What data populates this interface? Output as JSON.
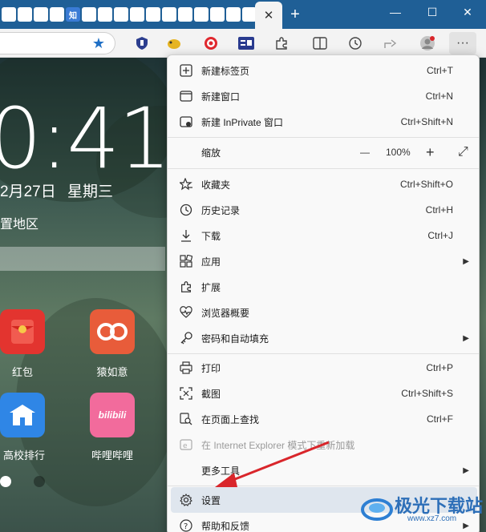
{
  "tabs": {
    "favicon_labels": [
      "",
      "",
      "",
      "",
      "知",
      "",
      "",
      "",
      "",
      "",
      "",
      "",
      "",
      "",
      "",
      ""
    ],
    "close": "✕",
    "new_tab": "+"
  },
  "window": {
    "minimize": "—",
    "maximize": "☐",
    "close": "✕"
  },
  "wallpaper": {
    "time": "0:41",
    "date": "2月27日",
    "weekday": "星期三",
    "location": "置地区",
    "apps": [
      {
        "label": "红包"
      },
      {
        "label": "猿如意"
      },
      {
        "label": "高校排行"
      },
      {
        "label": "哔哩哔哩",
        "tile_text": "bilibili"
      }
    ]
  },
  "menu": {
    "items": [
      {
        "label": "新建标签页",
        "shortcut": "Ctrl+T",
        "icon": "new-tab-icon"
      },
      {
        "label": "新建窗口",
        "shortcut": "Ctrl+N",
        "icon": "new-window-icon"
      },
      {
        "label": "新建 InPrivate 窗口",
        "shortcut": "Ctrl+Shift+N",
        "icon": "inprivate-icon"
      },
      {
        "label": "缩放",
        "icon": ""
      },
      {
        "label": "收藏夹",
        "shortcut": "Ctrl+Shift+O",
        "icon": "favorites-icon"
      },
      {
        "label": "历史记录",
        "shortcut": "Ctrl+H",
        "icon": "history-icon"
      },
      {
        "label": "下载",
        "shortcut": "Ctrl+J",
        "icon": "download-icon"
      },
      {
        "label": "应用",
        "icon": "apps-icon",
        "submenu": true
      },
      {
        "label": "扩展",
        "icon": "extensions-icon"
      },
      {
        "label": "浏览器概要",
        "icon": "browser-essentials-icon"
      },
      {
        "label": "密码和自动填充",
        "icon": "key-icon",
        "submenu": true
      },
      {
        "label": "打印",
        "shortcut": "Ctrl+P",
        "icon": "print-icon"
      },
      {
        "label": "截图",
        "shortcut": "Ctrl+Shift+S",
        "icon": "screenshot-icon"
      },
      {
        "label": "在页面上查找",
        "shortcut": "Ctrl+F",
        "icon": "find-icon"
      },
      {
        "label": "在 Internet Explorer 模式下重新加载",
        "icon": "ie-icon",
        "disabled": true
      },
      {
        "label": "更多工具",
        "icon": "",
        "submenu": true
      },
      {
        "label": "设置",
        "icon": "settings-icon",
        "highlighted": true
      },
      {
        "label": "帮助和反馈",
        "icon": "help-icon",
        "submenu": true
      }
    ],
    "zoom": {
      "minus": "—",
      "value": "100%",
      "plus": "+",
      "fullscreen": "⤢"
    }
  },
  "watermark": {
    "text": "极光下载站",
    "url": "www.xz7.com"
  },
  "colors": {
    "titlebar": "#1f5f96",
    "menu_bg": "#f9f9f9",
    "highlight": "#dfe6ee",
    "arrow": "#d9262b"
  }
}
